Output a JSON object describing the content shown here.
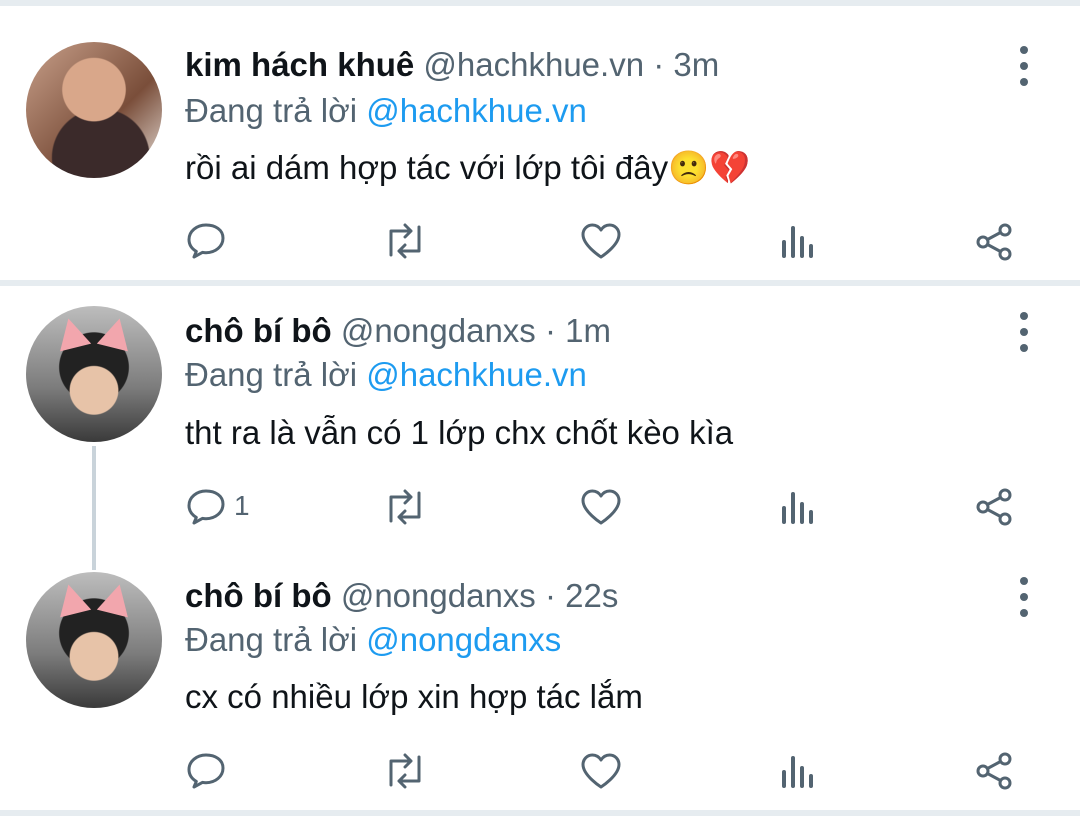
{
  "tweets": [
    {
      "display_name": "kim hách khuê",
      "handle": "@hachkhue.vn",
      "time": "· 3m",
      "reply_prefix": "Đang trả lời",
      "reply_to": "@hachkhue.vn",
      "text": "rồi ai dám hợp tác với lớp tôi đây",
      "emoji": "🙁💔",
      "reply_count": ""
    },
    {
      "display_name": "chô bí bô",
      "handle": "@nongdanxs",
      "time": "· 1m",
      "reply_prefix": "Đang trả lời",
      "reply_to": "@hachkhue.vn",
      "text": "tht ra là vẫn có 1 lớp chx chốt kèo kìa",
      "emoji": "",
      "reply_count": "1"
    },
    {
      "display_name": "chô bí bô",
      "handle": "@nongdanxs",
      "time": "· 22s",
      "reply_prefix": "Đang trả lời",
      "reply_to": "@nongdanxs",
      "text": "cx có nhiều lớp xin hợp tác lắm",
      "emoji": "",
      "reply_count": ""
    }
  ],
  "icons": [
    "reply-icon",
    "retweet-icon",
    "like-icon",
    "views-icon",
    "share-icon",
    "more-icon"
  ],
  "colors": {
    "mention": "#1d9bf0",
    "secondary": "#536471",
    "divider": "#e6ecf0"
  }
}
